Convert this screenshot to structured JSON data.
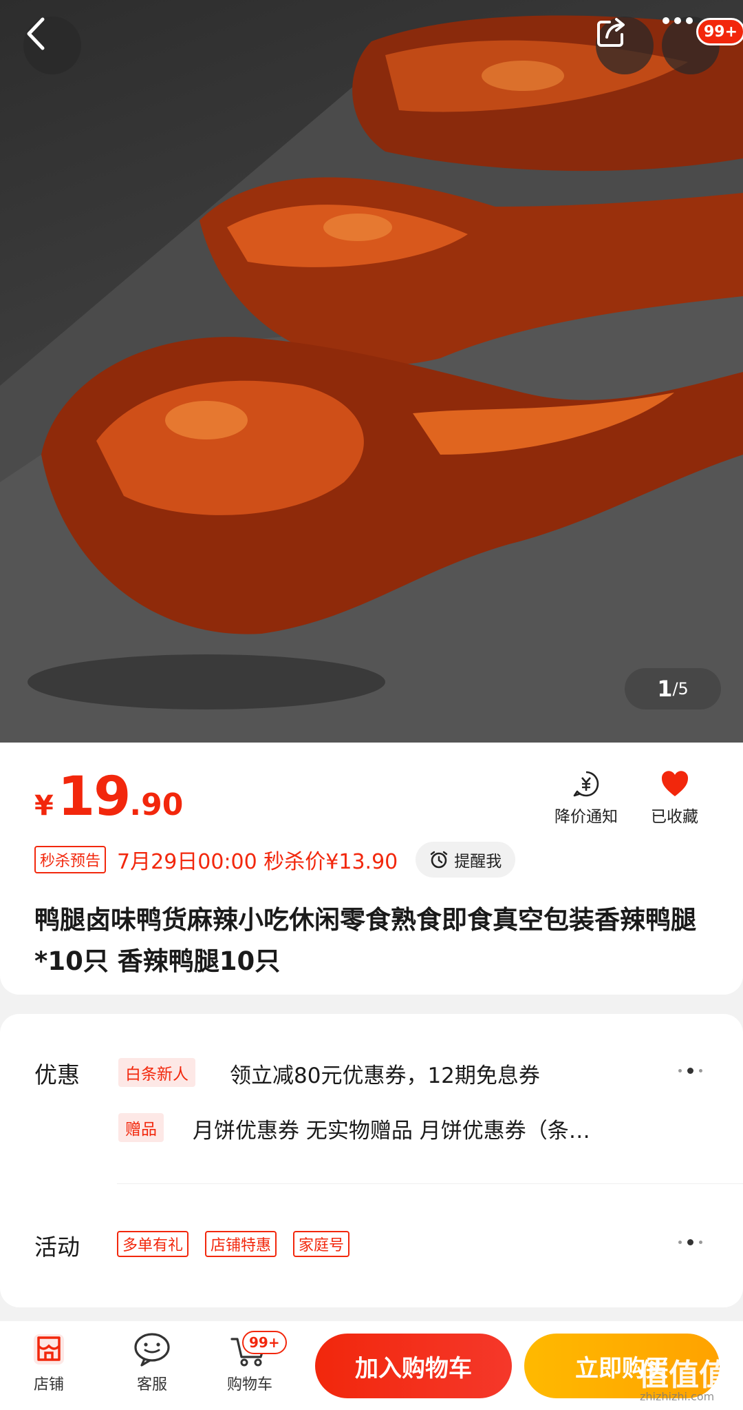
{
  "header": {
    "back_icon": "back-arrow-icon",
    "share_icon": "share-icon",
    "more_icon": "more-dots-icon",
    "message_badge": "99+"
  },
  "gallery": {
    "current": "1",
    "total": "/5"
  },
  "price": {
    "symbol": "¥",
    "integer": "19",
    "decimal": ".90",
    "color": "#f2270c"
  },
  "actions": {
    "price_alert": "降价通知",
    "favorite": "已收藏"
  },
  "flash_sale": {
    "tag": "秒杀预告",
    "text": "7月29日00:00 秒杀价¥13.90",
    "remind_label": "提醒我"
  },
  "product": {
    "title": "鸭腿卤味鸭货麻辣小吃休闲零食熟食即食真空包装香辣鸭腿*10只 香辣鸭腿10只"
  },
  "promotions": {
    "label": "优惠",
    "items": [
      {
        "tag": "白条新人",
        "text": "领立减80元优惠券，12期免息券"
      },
      {
        "tag": "赠品",
        "text": "月饼优惠券 无实物赠品 月饼优惠券（条…"
      }
    ]
  },
  "activities": {
    "label": "活动",
    "tags": [
      "多单有礼",
      "店铺特惠",
      "家庭号"
    ]
  },
  "bottom_bar": {
    "store": "店铺",
    "service": "客服",
    "cart": "购物车",
    "cart_badge": "99+",
    "add_to_cart": "加入购物车",
    "buy_now": "立即购买",
    "buy_accent": "#ffb900"
  },
  "watermark": {
    "logo": "值值值",
    "url": "zhizhizhi.com"
  }
}
